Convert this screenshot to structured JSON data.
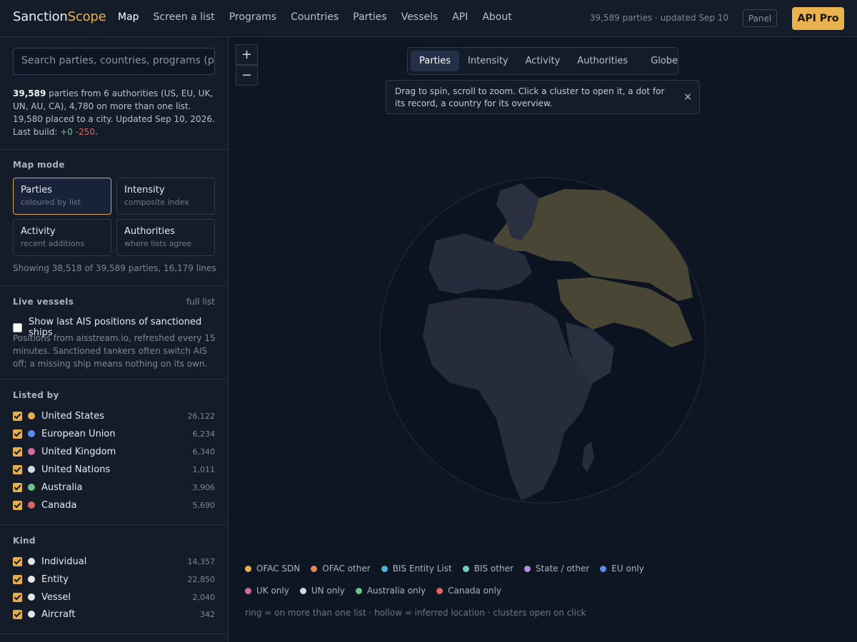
{
  "app": {
    "logo_main": "Sanction",
    "logo_accent": "Scope"
  },
  "nav": {
    "items": [
      "Map",
      "Screen a list",
      "Programs",
      "Countries",
      "Parties",
      "Vessels",
      "API",
      "About"
    ],
    "active": "Map"
  },
  "header": {
    "meta": "39,589 parties · updated Sep 10",
    "panel_label": "Panel",
    "pro_label": "API Pro"
  },
  "search": {
    "placeholder": "Search parties, countries, programs  (pr"
  },
  "summary": {
    "count": "39,589",
    "text": " parties from 6 authorities (US, EU, UK, UN, AU, CA), 4,780 on more than one list. 19,580 placed to a city. Updated Sep 10, 2026. Last build: ",
    "plus": "+0",
    "minus": "-250",
    "end": "."
  },
  "map_mode": {
    "title": "Map mode",
    "cards": [
      {
        "title": "Parties",
        "sub": "coloured by list",
        "active": true
      },
      {
        "title": "Intensity",
        "sub": "composite index",
        "active": false
      },
      {
        "title": "Activity",
        "sub": "recent additions",
        "active": false
      },
      {
        "title": "Authorities",
        "sub": "where lists agree",
        "active": false
      }
    ],
    "showing": "Showing 38,518 of 39,589 parties, 16,179 lines"
  },
  "live_vessels": {
    "title": "Live vessels",
    "link": "full list",
    "checkbox_label": "Show last AIS positions of sanctioned ships",
    "checked": false,
    "description": "Positions from aisstream.io, refreshed every 15 minutes. Sanctioned tankers often switch AIS off; a missing ship means nothing on its own."
  },
  "listed_by": {
    "title": "Listed by",
    "items": [
      {
        "label": "United States",
        "count": "26,122",
        "color": "#e8b04a"
      },
      {
        "label": "European Union",
        "count": "6,234",
        "color": "#5b8def"
      },
      {
        "label": "United Kingdom",
        "count": "6,340",
        "color": "#d46ba4"
      },
      {
        "label": "United Nations",
        "count": "1,011",
        "color": "#d9d9d9"
      },
      {
        "label": "Australia",
        "count": "3,906",
        "color": "#6cc38a"
      },
      {
        "label": "Canada",
        "count": "5,690",
        "color": "#e0635c"
      }
    ]
  },
  "kind": {
    "title": "Kind",
    "items": [
      {
        "label": "Individual",
        "count": "14,357",
        "color": "#e6e6e6"
      },
      {
        "label": "Entity",
        "count": "22,850",
        "color": "#e6e6e6"
      },
      {
        "label": "Vessel",
        "count": "2,040",
        "color": "#e6e6e6"
      },
      {
        "label": "Aircraft",
        "count": "342",
        "color": "#e6e6e6"
      }
    ]
  },
  "map": {
    "zoom_in": "+",
    "zoom_out": "−",
    "tabs": [
      "Parties",
      "Intensity",
      "Activity",
      "Authorities",
      "Globe"
    ],
    "active_tab": "Parties",
    "hint": "Drag to spin, scroll to zoom. Click a cluster to open it, a dot for its record, a country for its overview.",
    "hint_close": "×"
  },
  "legend": {
    "items": [
      {
        "label": "OFAC SDN",
        "color": "#e8b04a"
      },
      {
        "label": "OFAC other",
        "color": "#e0885c"
      },
      {
        "label": "BIS Entity List",
        "color": "#4fb3d9"
      },
      {
        "label": "BIS other",
        "color": "#6fd1b8"
      },
      {
        "label": "State / other",
        "color": "#b18be6"
      },
      {
        "label": "EU only",
        "color": "#5b8def"
      },
      {
        "label": "UK only",
        "color": "#d46ba4"
      },
      {
        "label": "UN only",
        "color": "#d9d9d9"
      },
      {
        "label": "Australia only",
        "color": "#6cc38a"
      },
      {
        "label": "Canada only",
        "color": "#e0635c"
      }
    ],
    "note": "ring = on more than one list · hollow = inferred location · clusters open on click"
  }
}
